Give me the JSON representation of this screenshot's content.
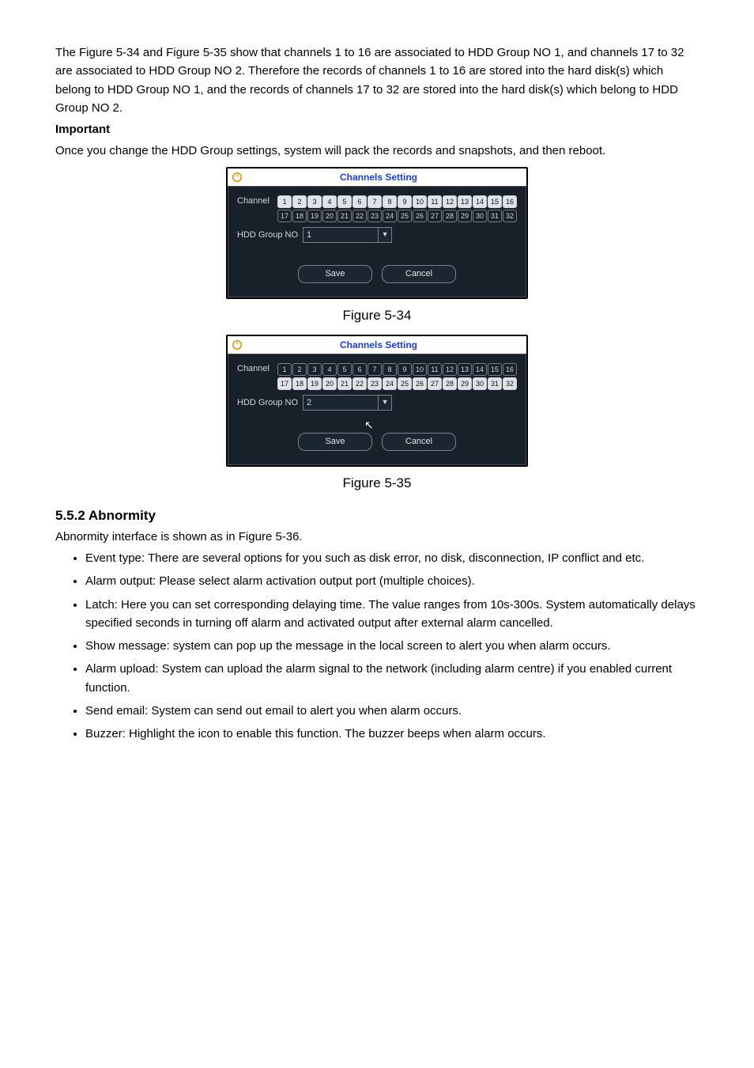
{
  "intro": {
    "p1": "The Figure 5-34 and Figure 5-35 show that channels 1 to 16 are associated to HDD Group NO 1, and channels 17 to 32 are associated to HDD Group NO 2. Therefore the records of channels 1 to 16 are stored into the hard disk(s) which belong to HDD Group NO 1, and the records of channels 17 to 32 are stored into the hard disk(s) which belong to HDD Group NO 2.",
    "important_label": "Important",
    "p2": "Once you change the HDD Group settings, system will pack the records and snapshots, and then reboot."
  },
  "dialog1": {
    "title": "Channels Setting",
    "channel_label": "Channel",
    "row1": [
      "1",
      "2",
      "3",
      "4",
      "5",
      "6",
      "7",
      "8",
      "9",
      "10",
      "11",
      "12",
      "13",
      "14",
      "15",
      "16"
    ],
    "row2": [
      "17",
      "18",
      "19",
      "20",
      "21",
      "22",
      "23",
      "24",
      "25",
      "26",
      "27",
      "28",
      "29",
      "30",
      "31",
      "32"
    ],
    "hdd_label": "HDD Group NO",
    "hdd_value": "1",
    "save": "Save",
    "cancel": "Cancel",
    "caption": "Figure 5-34"
  },
  "dialog2": {
    "title": "Channels Setting",
    "channel_label": "Channel",
    "row1": [
      "1",
      "2",
      "3",
      "4",
      "5",
      "6",
      "7",
      "8",
      "9",
      "10",
      "11",
      "12",
      "13",
      "14",
      "15",
      "16"
    ],
    "row2": [
      "17",
      "18",
      "19",
      "20",
      "21",
      "22",
      "23",
      "24",
      "25",
      "26",
      "27",
      "28",
      "29",
      "30",
      "31",
      "32"
    ],
    "hdd_label": "HDD Group NO",
    "hdd_value": "2",
    "save": "Save",
    "cancel": "Cancel",
    "caption": "Figure 5-35"
  },
  "section": {
    "heading": "5.5.2  Abnormity",
    "intro": "Abnormity interface is shown as in Figure 5-36.",
    "bullets": [
      "Event type: There are several options for you such as disk error, no disk, disconnection, IP conflict and etc.",
      "Alarm output: Please select alarm activation output port (multiple choices).",
      "Latch: Here you can set corresponding delaying time. The value ranges from 10s-300s. System automatically delays specified seconds in turning off alarm and activated output after external alarm cancelled.",
      "Show message: system can pop up the message in the local screen to alert you when alarm occurs.",
      "Alarm upload: System can upload the alarm signal to the network (including alarm centre) if you enabled current function.",
      "Send email: System can send out email to alert you when alarm occurs.",
      "Buzzer: Highlight the icon to enable this function. The buzzer beeps when alarm occurs."
    ]
  }
}
